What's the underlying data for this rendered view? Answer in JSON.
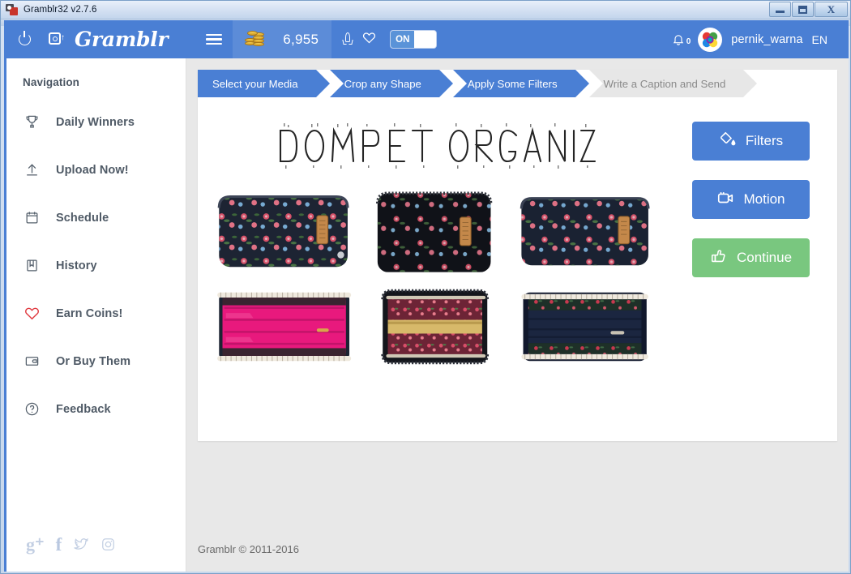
{
  "window": {
    "title": "Gramblr32 v2.7.6",
    "buttons": {
      "minimize": "minimize",
      "maximize": "maximize",
      "close": "X"
    }
  },
  "topbar": {
    "power_icon": "power-icon",
    "upload_icon": "camera-upload-icon",
    "brand": "Gramblr",
    "menu_icon": "hamburger-menu-icon",
    "coins_icon": "coin-stack-icon",
    "coins_count": "6,955",
    "rocket_icon": "rocket-icon",
    "heart_icon": "heart-outline-icon",
    "toggle_label": "ON",
    "bell_icon": "bell-icon",
    "notification_count": "0",
    "avatar": "user-avatar",
    "username": "pernik_warna",
    "language": "EN"
  },
  "sidebar": {
    "title": "Navigation",
    "items": [
      {
        "label": "Daily Winners",
        "icon": "trophy-icon"
      },
      {
        "label": "Upload Now!",
        "icon": "upload-arrow-icon"
      },
      {
        "label": "Schedule",
        "icon": "calendar-icon"
      },
      {
        "label": "History",
        "icon": "bookmark-icon"
      },
      {
        "label": "Earn Coins!",
        "icon": "heart-icon"
      },
      {
        "label": "Or Buy Them",
        "icon": "wallet-icon"
      },
      {
        "label": "Feedback",
        "icon": "question-circle-icon"
      }
    ],
    "socials": [
      {
        "name": "google-plus-icon",
        "glyph": "g+"
      },
      {
        "name": "facebook-icon",
        "glyph": "f"
      },
      {
        "name": "twitter-icon",
        "glyph": "twitter"
      },
      {
        "name": "instagram-icon",
        "glyph": "instagram"
      }
    ]
  },
  "steps": [
    {
      "label": "Select your Media",
      "active": true
    },
    {
      "label": "Crop any Shape",
      "active": true
    },
    {
      "label": "Apply Some Filters",
      "active": true
    },
    {
      "label": "Write a Caption and Send",
      "active": false
    }
  ],
  "preview": {
    "heading_text": "DOMPET ORGANIZER",
    "photos": [
      {
        "name": "wallet-closed-front",
        "type": "closed",
        "body": "#1d2433",
        "tag": true
      },
      {
        "name": "wallet-closed-angled",
        "type": "closed",
        "body": "#14161c",
        "tag": true
      },
      {
        "name": "wallet-closed-side",
        "type": "closed",
        "body": "#1a2232",
        "tag": true
      },
      {
        "name": "wallet-open-pink",
        "type": "open",
        "lining": "#e8197d"
      },
      {
        "name": "wallet-open-floral",
        "type": "open",
        "lining": "#7a2b3a"
      },
      {
        "name": "wallet-open-navy",
        "type": "open",
        "lining": "#1b2640"
      }
    ]
  },
  "actions": {
    "filters": {
      "label": "Filters",
      "icon": "paint-bucket-icon",
      "color": "#4a7fd4"
    },
    "motion": {
      "label": "Motion",
      "icon": "video-camera-icon",
      "color": "#4a7fd4"
    },
    "continue": {
      "label": "Continue",
      "icon": "thumbs-up-icon",
      "color": "#79c77f"
    }
  },
  "footer": {
    "copyright": "Gramblr © 2011-2016"
  },
  "colors": {
    "brand_blue": "#4a7fd4",
    "success_green": "#79c77f",
    "page_bg": "#e8e8e8",
    "sidebar_text": "#4f5a66",
    "accent_red": "#e0383e"
  }
}
